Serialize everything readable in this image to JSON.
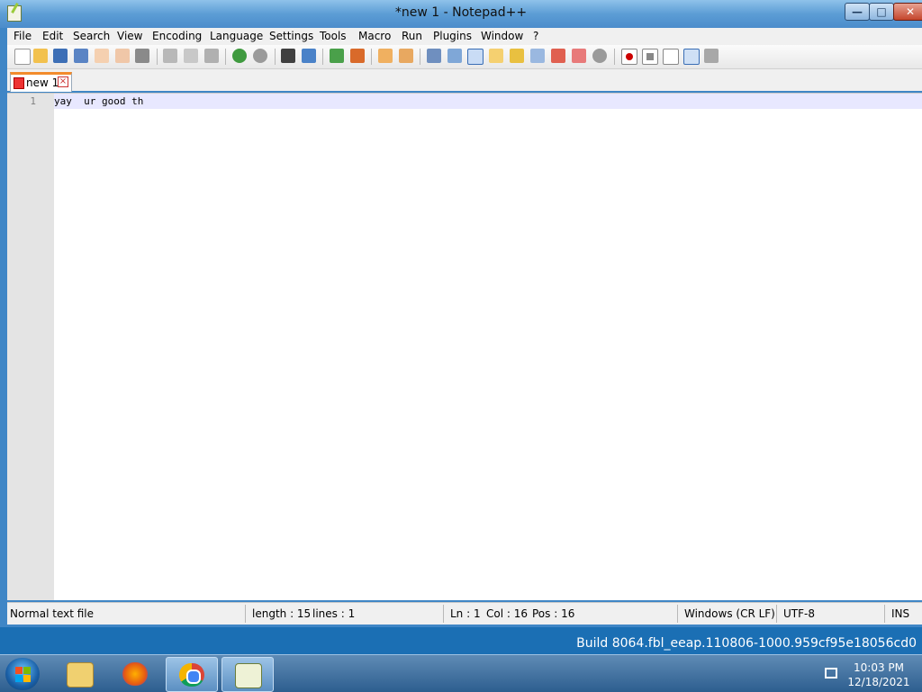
{
  "window": {
    "title": "*new 1 - Notepad++",
    "buttons": {
      "minimize": "—",
      "maximize": "□",
      "close": "✕"
    }
  },
  "menubar": {
    "items": [
      "File",
      "Edit",
      "Search",
      "View",
      "Encoding",
      "Language",
      "Settings",
      "Tools",
      "Macro",
      "Run",
      "Plugins",
      "Window",
      "?"
    ]
  },
  "toolbar": {
    "icons": [
      "new-file-icon",
      "open-file-icon",
      "save-icon",
      "save-all-icon",
      "close-icon",
      "close-all-icon",
      "print-icon",
      "cut-icon",
      "copy-icon",
      "paste-icon",
      "undo-icon",
      "redo-icon",
      "find-icon",
      "replace-icon",
      "zoom-in-icon",
      "zoom-out-icon",
      "sync-vertical-icon",
      "sync-horizontal-icon",
      "word-wrap-icon",
      "show-all-chars-icon",
      "indent-guide-icon",
      "udl-icon",
      "doc-map-icon",
      "function-list-icon",
      "folder-workspace-icon",
      "monitor-icon",
      "record-macro-icon",
      "stop-macro-icon",
      "play-macro-icon",
      "run-macro-multiple-icon",
      "save-macro-icon"
    ]
  },
  "tabs": [
    {
      "label": "new 1",
      "modified": true
    }
  ],
  "editor": {
    "lines": [
      {
        "number": "1",
        "text": "yay  ur good th"
      }
    ]
  },
  "statusbar": {
    "file_type": "Normal text file",
    "length": "length : 15",
    "lines": "lines : 1",
    "ln": "Ln : 1",
    "col": "Col : 16",
    "pos": "Pos : 16",
    "eol": "Windows (CR LF)",
    "encoding": "UTF-8",
    "mode": "INS"
  },
  "desktop": {
    "build": "Build 8064.fbl_eeap.110806-1000.959cf95e18056cd0"
  },
  "taskbar": {
    "apps": [
      "file-explorer-icon",
      "firefox-icon",
      "chrome-icon",
      "notepadpp-icon"
    ],
    "clock_time": "10:03 PM",
    "clock_date": "12/18/2021"
  },
  "colors": {
    "tab_accent": "#f28b2c",
    "current_line": "#e8e8ff",
    "gutter": "#e4e4e4",
    "titlebar": "#5c9dd5"
  }
}
